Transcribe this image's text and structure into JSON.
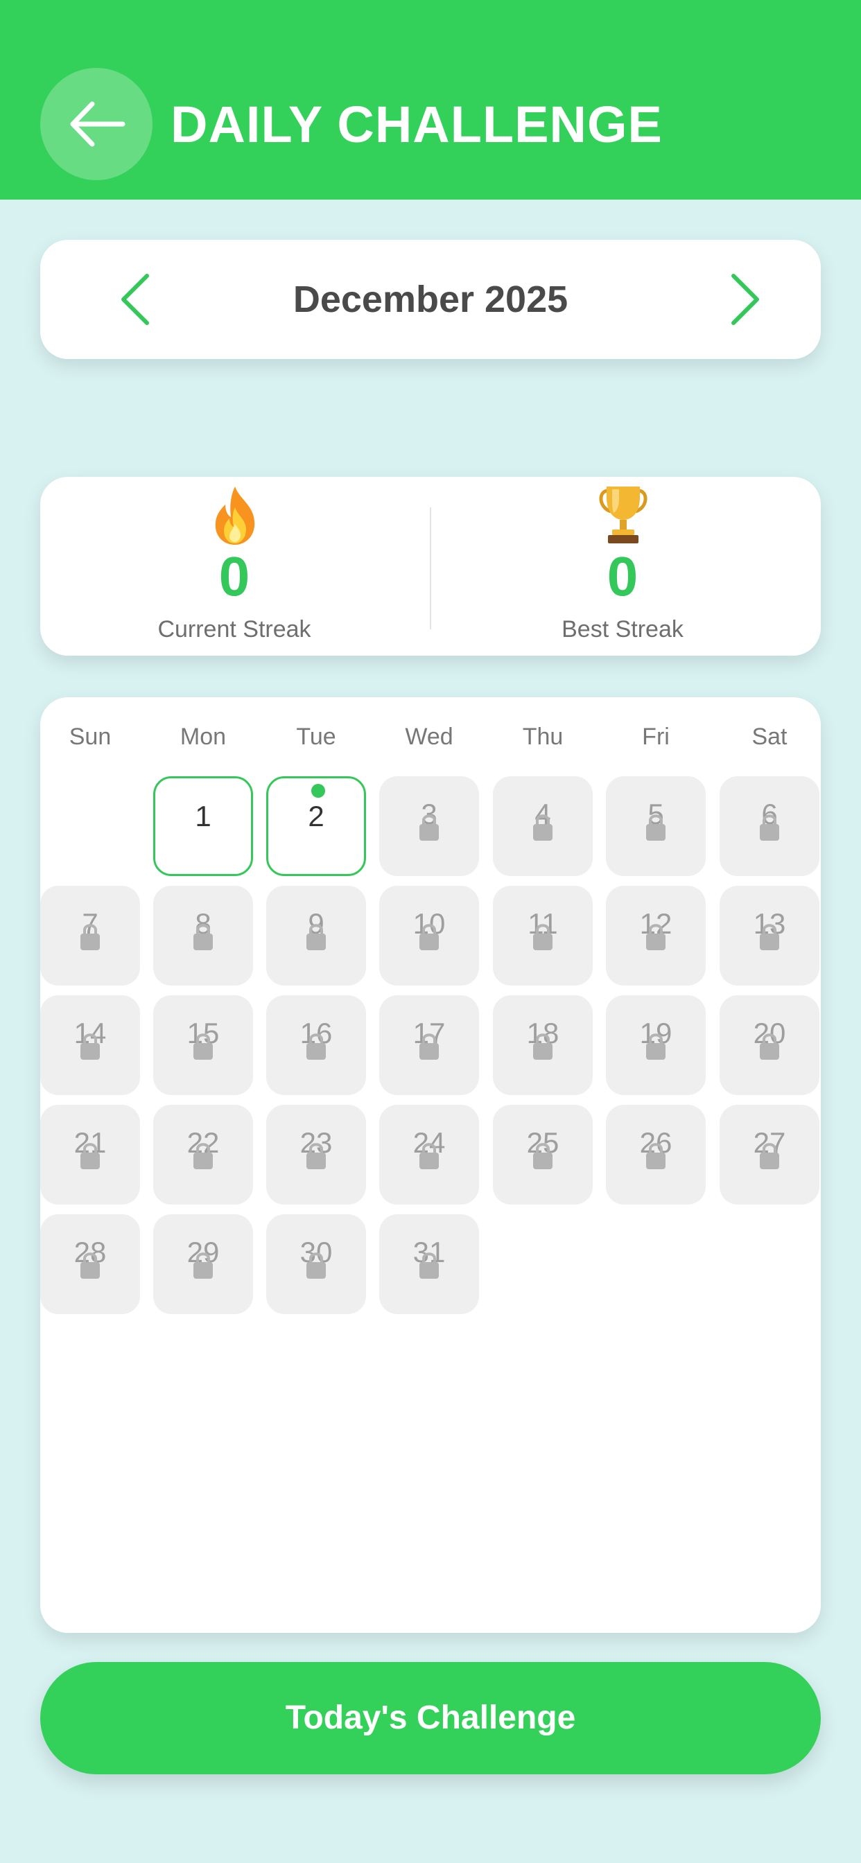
{
  "header": {
    "title": "DAILY CHALLENGE",
    "back_icon": "arrow-left-icon",
    "color": "#34d15a"
  },
  "month_nav": {
    "label": "December 2025",
    "prev_icon": "chevron-left-icon",
    "next_icon": "chevron-right-icon"
  },
  "stats": {
    "current": {
      "icon": "fire-icon",
      "value": "0",
      "label": "Current Streak"
    },
    "best": {
      "icon": "trophy-icon",
      "value": "0",
      "label": "Best Streak"
    }
  },
  "calendar": {
    "weekdays": [
      "Sun",
      "Mon",
      "Tue",
      "Wed",
      "Thu",
      "Fri",
      "Sat"
    ],
    "first_weekday_index": 1,
    "days": [
      {
        "num": "1",
        "locked": false,
        "today": false
      },
      {
        "num": "2",
        "locked": false,
        "today": true
      },
      {
        "num": "3",
        "locked": true
      },
      {
        "num": "4",
        "locked": true
      },
      {
        "num": "5",
        "locked": true
      },
      {
        "num": "6",
        "locked": true
      },
      {
        "num": "7",
        "locked": true
      },
      {
        "num": "8",
        "locked": true
      },
      {
        "num": "9",
        "locked": true
      },
      {
        "num": "10",
        "locked": true
      },
      {
        "num": "11",
        "locked": true
      },
      {
        "num": "12",
        "locked": true
      },
      {
        "num": "13",
        "locked": true
      },
      {
        "num": "14",
        "locked": true
      },
      {
        "num": "15",
        "locked": true
      },
      {
        "num": "16",
        "locked": true
      },
      {
        "num": "17",
        "locked": true
      },
      {
        "num": "18",
        "locked": true
      },
      {
        "num": "19",
        "locked": true
      },
      {
        "num": "20",
        "locked": true
      },
      {
        "num": "21",
        "locked": true
      },
      {
        "num": "22",
        "locked": true
      },
      {
        "num": "23",
        "locked": true
      },
      {
        "num": "24",
        "locked": true
      },
      {
        "num": "25",
        "locked": true
      },
      {
        "num": "26",
        "locked": true
      },
      {
        "num": "27",
        "locked": true
      },
      {
        "num": "28",
        "locked": true
      },
      {
        "num": "29",
        "locked": true
      },
      {
        "num": "30",
        "locked": true
      },
      {
        "num": "31",
        "locked": true
      }
    ],
    "accent": "#34c759",
    "lock_icon": "lock-icon"
  },
  "cta": {
    "label": "Today's Challenge"
  }
}
